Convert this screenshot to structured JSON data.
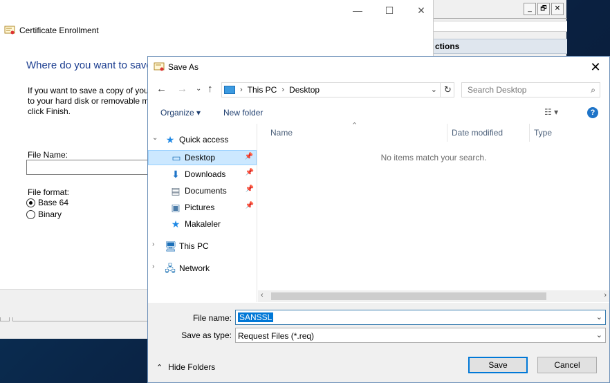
{
  "background_window": {
    "header": "ctions",
    "buttons": [
      "_",
      "🗗",
      "✕"
    ]
  },
  "wizard": {
    "title": "Certificate Enrollment",
    "heading": "Where do you want to save",
    "description_lines": [
      "If you want to save a copy of your",
      "to your hard disk or removable m",
      "click Finish."
    ],
    "file_name_label": "File Name:",
    "file_format_label": "File format:",
    "formats": [
      {
        "label": "Base 64",
        "selected": true
      },
      {
        "label": "Binary",
        "selected": false
      }
    ],
    "window_controls": [
      "—",
      "☐",
      "✕"
    ]
  },
  "dialog": {
    "title": "Save As",
    "close_glyph": "✕",
    "address": {
      "crumbs": [
        "This PC",
        "Desktop"
      ]
    },
    "search": {
      "placeholder": "Search Desktop"
    },
    "toolbar": {
      "organize": "Organize ▾",
      "new_folder": "New folder"
    },
    "nav": {
      "quick_access": "Quick access",
      "items": [
        {
          "label": "Desktop",
          "icon": "desktop-icon",
          "pinned": true,
          "selected": true
        },
        {
          "label": "Downloads",
          "icon": "download-icon",
          "pinned": true
        },
        {
          "label": "Documents",
          "icon": "document-icon",
          "pinned": true
        },
        {
          "label": "Pictures",
          "icon": "pictures-icon",
          "pinned": true
        },
        {
          "label": "Makaleler",
          "icon": "star-icon",
          "pinned": false
        }
      ],
      "this_pc": "This PC",
      "network": "Network"
    },
    "columns": [
      "Name",
      "Date modified",
      "Type"
    ],
    "empty_message": "No items match your search.",
    "file_name_label": "File name:",
    "file_name_value": "SANSSL",
    "save_as_type_label": "Save as type:",
    "save_as_type_value": "Request Files (*.req)",
    "hide_folders": "Hide Folders",
    "save_button": "Save",
    "cancel_button": "Cancel"
  },
  "colors": {
    "accent": "#0078d7",
    "heading_blue": "#1a3c8f",
    "selection_bg": "#cce8ff"
  }
}
